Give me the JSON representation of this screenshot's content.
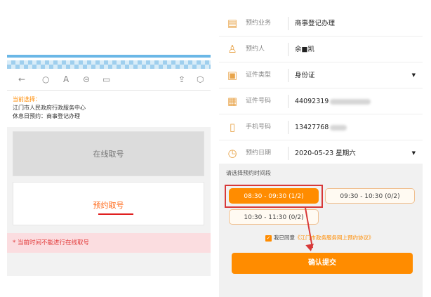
{
  "left": {
    "toolbar_icons": [
      "back-arrow-icon",
      "refresh-icon",
      "text-icon",
      "link-icon",
      "calendar-icon",
      "share-icon",
      "cube-icon"
    ],
    "selection_label": "当前选择：",
    "selection_lines": [
      "江门市人民政府行政服务中心",
      "休息日预约：商事登记办理"
    ],
    "online_button": "在线取号",
    "reserve_button": "预约取号",
    "notice": "* 当前时间不能进行在线取号"
  },
  "right": {
    "fields": [
      {
        "icon": "document-icon",
        "label": "预约业务",
        "value": "商事登记办理",
        "dropdown": false
      },
      {
        "icon": "person-icon",
        "label": "预约人",
        "value": "余■凯",
        "dropdown": false
      },
      {
        "icon": "id-card-icon",
        "label": "证件类型",
        "value": "身份证",
        "dropdown": true
      },
      {
        "icon": "id-number-icon",
        "label": "证件号码",
        "value": "44092319",
        "dropdown": false
      },
      {
        "icon": "phone-icon",
        "label": "手机号码",
        "value": "13427768",
        "dropdown": false
      },
      {
        "icon": "clock-icon",
        "label": "预约日期",
        "value": "2020-05-23 星期六",
        "dropdown": true
      }
    ],
    "time_hint": "请选择预约时间段",
    "slots": [
      {
        "label": "08:30 - 09:30 (1/2)",
        "selected": true
      },
      {
        "label": "09:30 - 10:30 (0/2)",
        "selected": false
      },
      {
        "label": "10:30 - 11:30 (0/2)",
        "selected": false
      }
    ],
    "agree_text": "我已同意",
    "agree_link": "《江门市政务服务网上预约协议》",
    "submit": "确认提交",
    "caret": "▼",
    "check": "✓"
  },
  "colors": {
    "accent": "#ff8c00",
    "highlight": "#d83838",
    "notice_bg": "#fbdde0"
  }
}
